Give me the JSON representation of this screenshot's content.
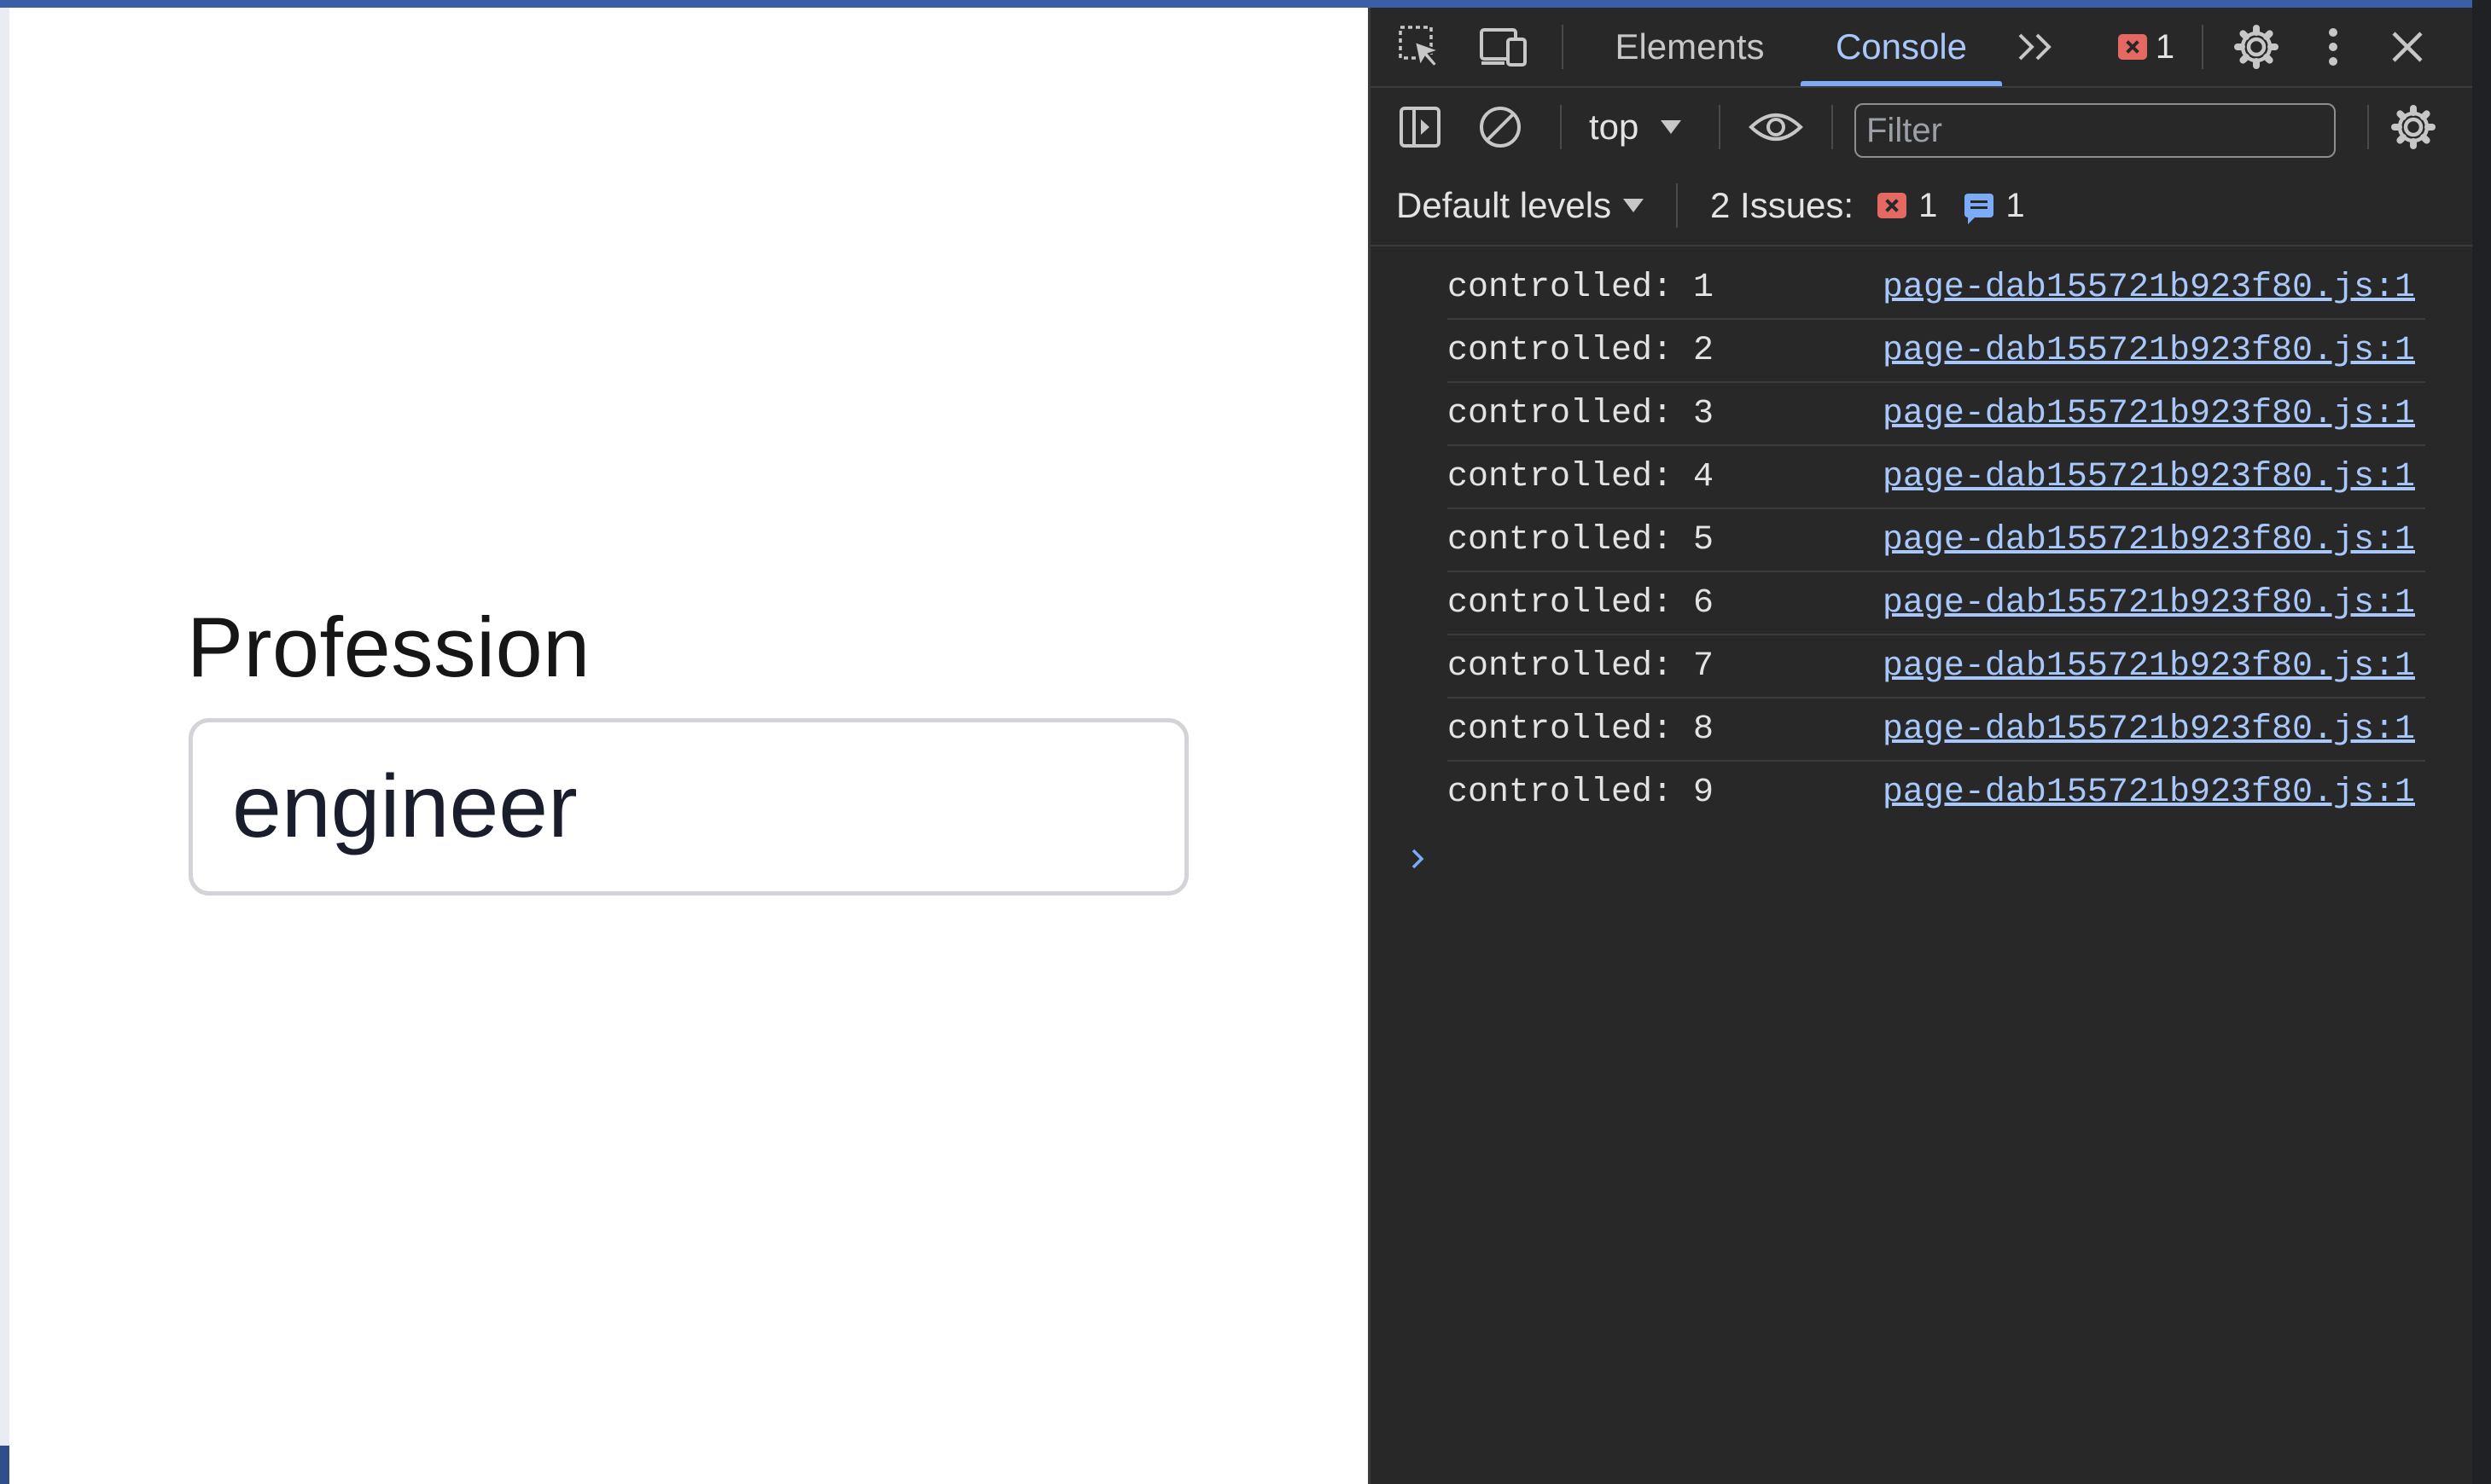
{
  "page": {
    "field_label": "Profession",
    "input_value": "engineer"
  },
  "devtools": {
    "tabs": [
      {
        "label": "Elements",
        "active": false
      },
      {
        "label": "Console",
        "active": true
      }
    ],
    "error_count": "1",
    "context": "top",
    "filter_placeholder": "Filter",
    "levels": "Default levels",
    "issues_label": "2 Issues:",
    "issues_error_count": "1",
    "issues_info_count": "1",
    "logs": [
      {
        "text": "controlled: 1",
        "source": "page-dab155721b923f80.js:1"
      },
      {
        "text": "controlled: 2",
        "source": "page-dab155721b923f80.js:1"
      },
      {
        "text": "controlled: 3",
        "source": "page-dab155721b923f80.js:1"
      },
      {
        "text": "controlled: 4",
        "source": "page-dab155721b923f80.js:1"
      },
      {
        "text": "controlled: 5",
        "source": "page-dab155721b923f80.js:1"
      },
      {
        "text": "controlled: 6",
        "source": "page-dab155721b923f80.js:1"
      },
      {
        "text": "controlled: 7",
        "source": "page-dab155721b923f80.js:1"
      },
      {
        "text": "controlled: 8",
        "source": "page-dab155721b923f80.js:1"
      },
      {
        "text": "controlled: 9",
        "source": "page-dab155721b923f80.js:1"
      }
    ],
    "icons": [
      "inspect-element-icon",
      "device-toolbar-icon",
      "more-tabs-icon",
      "error-icon",
      "settings-gear-icon",
      "kebab-menu-icon",
      "close-icon",
      "sidebar-toggle-icon",
      "clear-console-icon",
      "live-expression-eye-icon",
      "console-settings-gear-icon",
      "info-message-icon",
      "prompt-chevron-icon"
    ],
    "colors": {
      "background": "#282828",
      "active_tab": "#a8c7fa",
      "link": "#a8c7fa",
      "error": "#e46962",
      "info": "#7cacf8"
    }
  }
}
